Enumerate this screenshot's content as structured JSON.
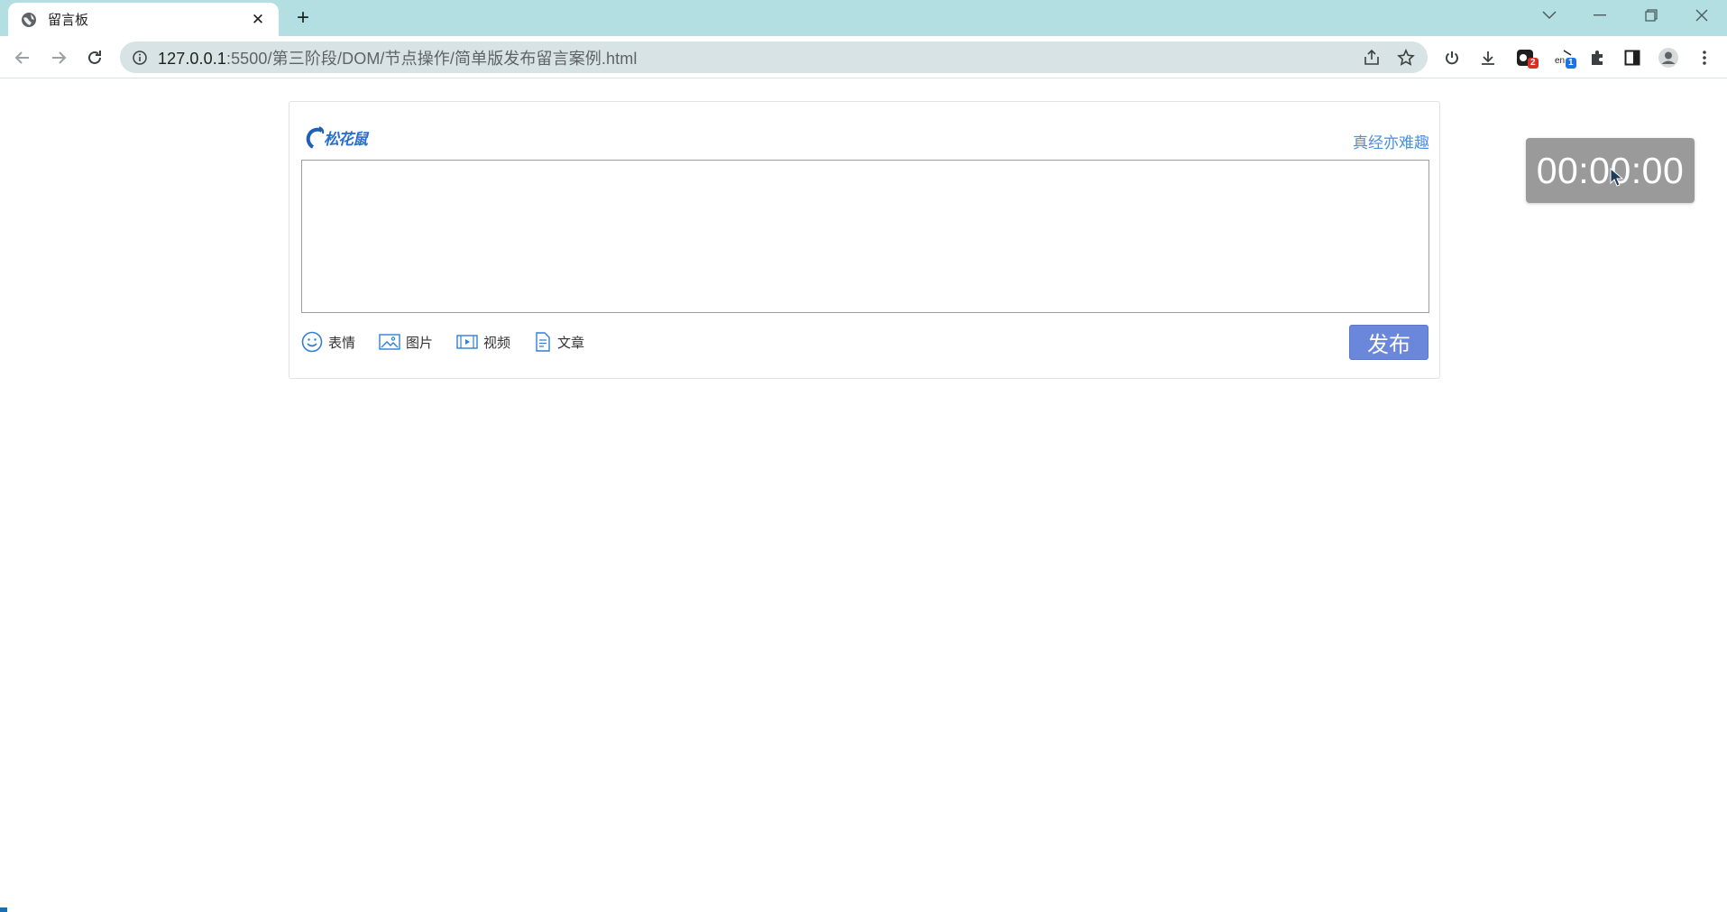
{
  "browser": {
    "tab_title": "留言板",
    "url_host": "127.0.0.1",
    "url_path": ":5500/第三阶段/DOM/节点操作/简单版发布留言案例.html",
    "ext_badge_red": "2",
    "ext_badge_blue": "1"
  },
  "page": {
    "logo_text": "松花鼠",
    "tagline": "真经亦难趣",
    "textarea_placeholder": "",
    "tools": [
      {
        "label": "表情",
        "icon": "smile-icon"
      },
      {
        "label": "图片",
        "icon": "image-icon"
      },
      {
        "label": "视频",
        "icon": "video-icon"
      },
      {
        "label": "文章",
        "icon": "document-icon"
      }
    ],
    "publish_label": "发布"
  },
  "timer": {
    "time": "00:00:00"
  }
}
